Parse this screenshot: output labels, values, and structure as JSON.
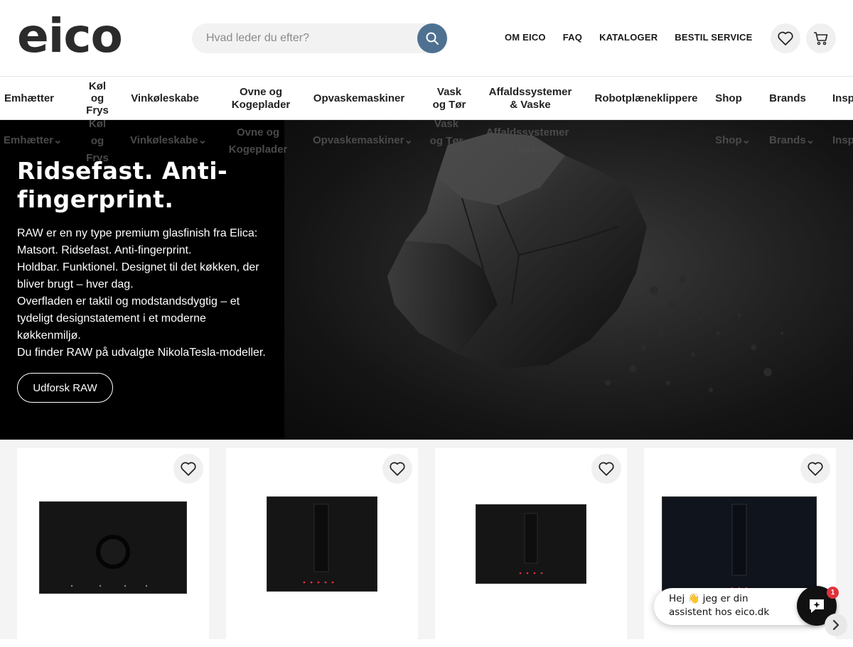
{
  "header": {
    "logo": "eico",
    "search_placeholder": "Hvad leder du efter?",
    "top_links": [
      "OM EICO",
      "FAQ",
      "KATALOGER",
      "BESTIL SERVICE"
    ]
  },
  "nav": {
    "items": [
      "Emhætter",
      "Køl og Frys",
      "Vinkøleskabe",
      "Ovne og Kogeplader",
      "Opvaskemaskiner",
      "Vask og Tør",
      "Affaldssystemer & Vaske",
      "Robotplæneklippere",
      "Shop",
      "Brands",
      "Insp"
    ]
  },
  "hero": {
    "title": "Ridsefast. Anti-fingerprint.",
    "paragraphs": [
      "RAW er en ny type premium glasfinish fra Elica: Matsort. Ridsefast. Anti-fingerprint.",
      "Holdbar. Funktionel. Designet til det køkken, der bliver brugt – hver dag.",
      "Overfladen er taktil og modstandsdygtig – et tydeligt designstatement i et moderne køkkenmiljø.",
      "Du finder RAW på udvalgte NikolaTesla-modeller."
    ],
    "button_label": "Udforsk RAW"
  },
  "chat": {
    "message": "Hej 👋 jeg er din assistent hos eico.dk",
    "badge": "1"
  },
  "colors": {
    "search_button": "#4e7191",
    "hero_bg": "#000000",
    "badge": "#e0323c"
  }
}
